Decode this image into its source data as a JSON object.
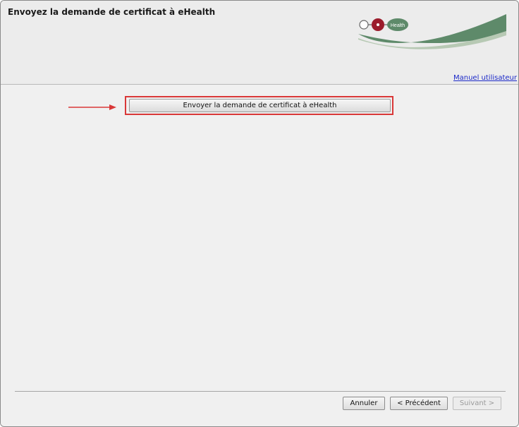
{
  "window": {
    "title": "Envoyez la demande de certificat à eHealth"
  },
  "logo": {
    "text": "Health",
    "brand_color": "#9b1c2c",
    "accent_green": "#5e8a6a"
  },
  "header": {
    "manual_link": "Manuel utilisateur"
  },
  "main": {
    "send_button_label": "Envoyer la demande de certificat à eHealth",
    "highlight_color": "#d93838"
  },
  "footer": {
    "cancel_label": "Annuler",
    "prev_label": "< Précédent",
    "next_label": "Suivant >",
    "next_disabled": true
  }
}
